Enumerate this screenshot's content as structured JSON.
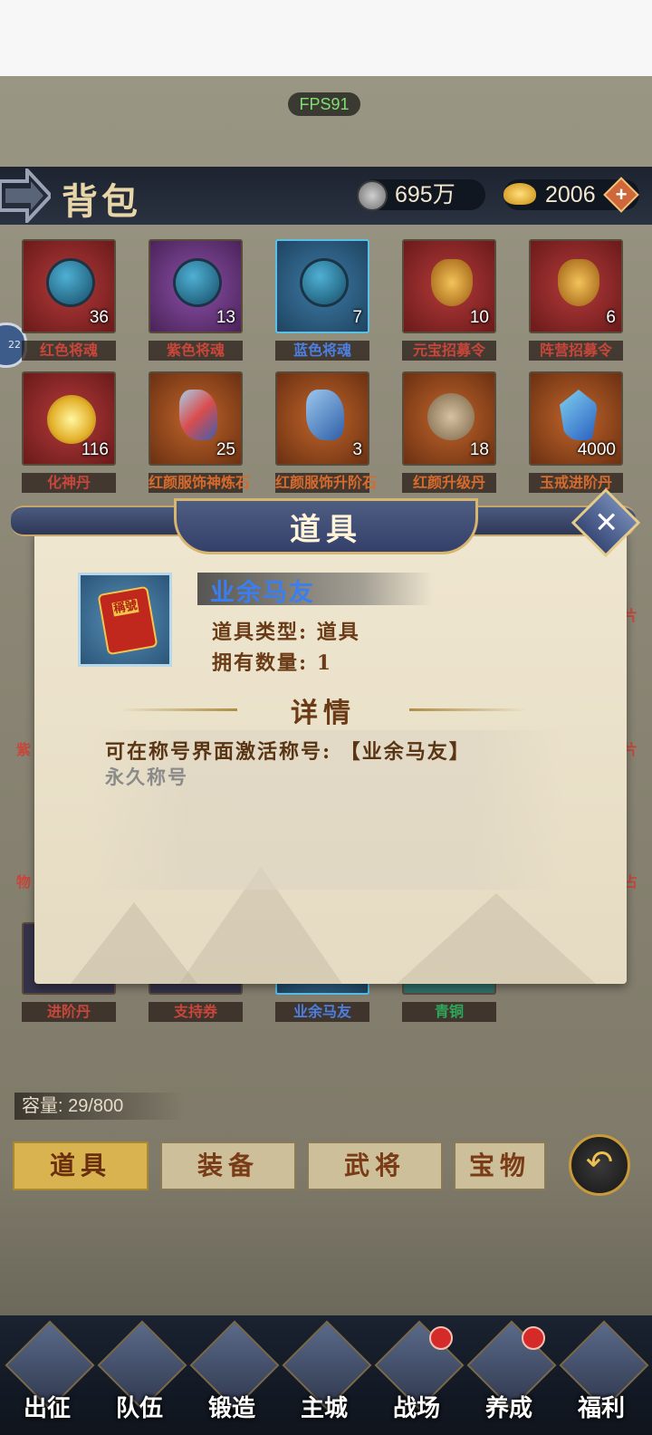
{
  "hud": {
    "fps": "FPS91"
  },
  "header": {
    "title": "背包",
    "coins": "695万",
    "gold": "2006",
    "plus": "+"
  },
  "side_badge": "22",
  "items": [
    {
      "label": "红色将魂",
      "count": "36",
      "color": "red",
      "icon": "orb"
    },
    {
      "label": "紫色将魂",
      "count": "13",
      "color": "purple",
      "icon": "orb"
    },
    {
      "label": "蓝色将魂",
      "count": "7",
      "color": "blue",
      "icon": "orb"
    },
    {
      "label": "元宝招募令",
      "count": "10",
      "color": "red",
      "icon": "pendant"
    },
    {
      "label": "阵营招募令",
      "count": "6",
      "color": "red",
      "icon": "pendant"
    },
    {
      "label": "化神丹",
      "count": "116",
      "color": "red",
      "icon": "pill"
    },
    {
      "label": "红颜服饰神炼石",
      "count": "25",
      "color": "orange",
      "icon": "stone-a"
    },
    {
      "label": "红颜服饰升阶石",
      "count": "3",
      "color": "orange",
      "icon": "stone-b"
    },
    {
      "label": "红颜升级丹",
      "count": "18",
      "color": "orange",
      "icon": "stone-c"
    },
    {
      "label": "玉戒进阶丹",
      "count": "4000",
      "color": "orange",
      "icon": "stone-d"
    },
    {
      "label": "进阶丹",
      "count": "",
      "color": "purple",
      "icon": ""
    },
    {
      "label": "支持券",
      "count": "",
      "color": "purple",
      "icon": ""
    },
    {
      "label": "业余马友",
      "count": "",
      "color": "blue",
      "icon": ""
    },
    {
      "label": "青铜",
      "count": "",
      "color": "green",
      "icon": ""
    }
  ],
  "partial_labels": {
    "row3_right": "片",
    "row4_left": "紫",
    "row4_right": "片",
    "row5_left": "物",
    "row5_right": "占"
  },
  "capacity": "容量: 29/800",
  "tabs": [
    "道具",
    "装备",
    "武将",
    "宝物"
  ],
  "nav": [
    {
      "label": "出征",
      "dot": false
    },
    {
      "label": "队伍",
      "dot": false
    },
    {
      "label": "锻造",
      "dot": false
    },
    {
      "label": "主城",
      "dot": false
    },
    {
      "label": "战场",
      "dot": true
    },
    {
      "label": "养成",
      "dot": true
    },
    {
      "label": "福利",
      "dot": false
    }
  ],
  "dialog": {
    "title": "道具",
    "close": "✕",
    "item_icon_text": "稱號",
    "item_name": "业余马友",
    "type_line": "道具类型: 道具",
    "count_line": "拥有数量: 1",
    "detail_title": "详情",
    "desc_line1": "可在称号界面激活称号: 【业余马友】",
    "desc_line2": "永久称号"
  },
  "colors": {
    "accent_gold": "#d8b350",
    "name_blue": "#3a7ef0",
    "label_red": "#c8463a"
  }
}
